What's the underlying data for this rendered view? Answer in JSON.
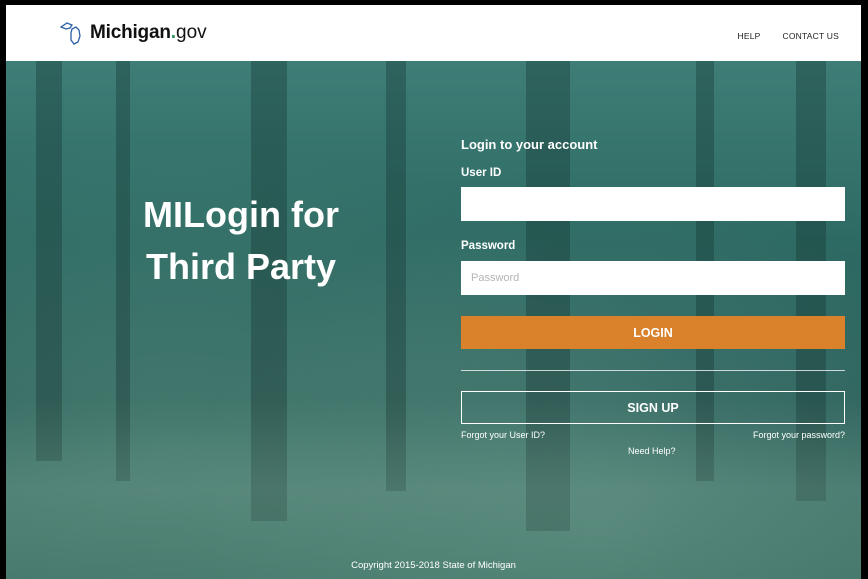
{
  "header": {
    "brand": "Michigan",
    "brand_dot": ".",
    "brand_suffix": "gov",
    "help_label": "HELP",
    "contact_label": "CONTACT US"
  },
  "hero": {
    "title_line1": "MILogin for",
    "title_line2": "Third Party"
  },
  "login": {
    "heading": "Login to your account",
    "userid_label": "User ID",
    "userid_value": "",
    "password_label": "Password",
    "password_placeholder": "Password",
    "login_button": "LOGIN",
    "signup_button": "SIGN UP",
    "forgot_userid": "Forgot your User ID?",
    "forgot_password": "Forgot your password?",
    "need_help": "Need Help?"
  },
  "footer": {
    "copyright": "Copyright 2015-2018 State of Michigan"
  },
  "colors": {
    "accent": "#d9822b",
    "background": "#2f6b64",
    "header": "#ffffff"
  }
}
